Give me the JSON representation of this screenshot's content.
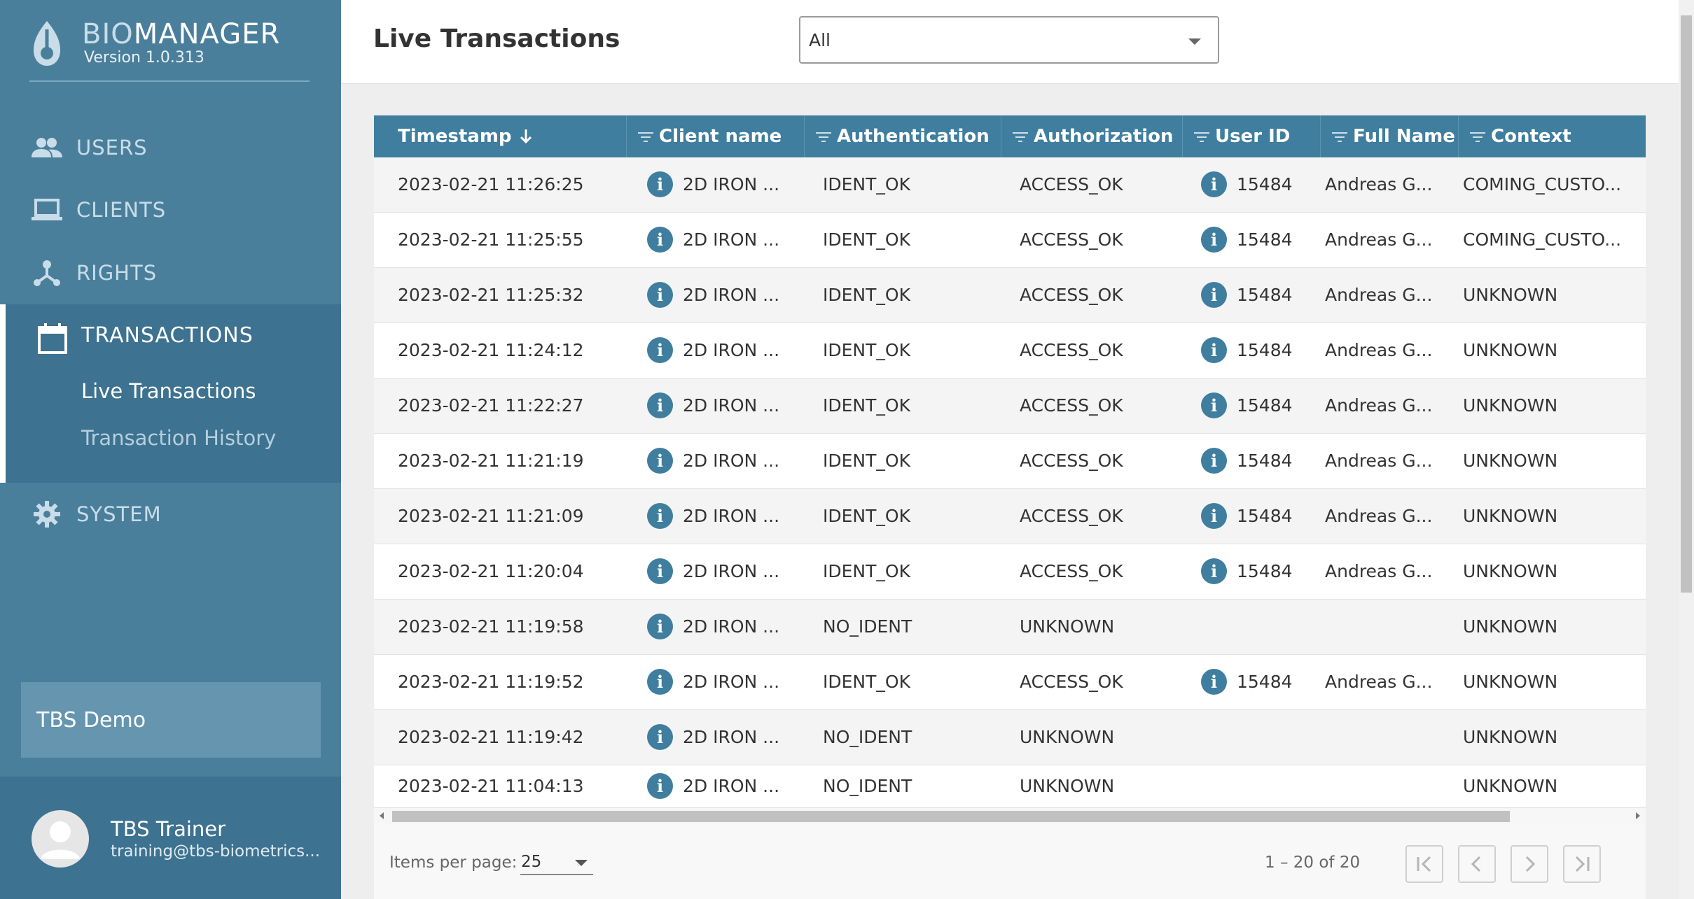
{
  "brand": {
    "name_part1": "BIO",
    "name_part2": "MANAGER",
    "version": "Version 1.0.313"
  },
  "nav": {
    "users": "USERS",
    "clients": "CLIENTS",
    "rights": "RIGHTS",
    "transactions": "TRANSACTIONS",
    "sub_live": "Live Transactions",
    "sub_history": "Transaction History",
    "system": "SYSTEM"
  },
  "tenant": "TBS Demo",
  "user": {
    "name": "TBS Trainer",
    "email": "training@tbs-biometrics..."
  },
  "header": {
    "title": "Live Transactions",
    "filter_value": "All"
  },
  "table": {
    "columns": [
      "Timestamp",
      "Client name",
      "Authentication",
      "Authorization",
      "User ID",
      "Full Name",
      "Context"
    ],
    "rows": [
      [
        "2023-02-21 11:26:25",
        "2D IRON ...",
        "IDENT_OK",
        "ACCESS_OK",
        "15484",
        "Andreas G...",
        "COMING_CUSTO..."
      ],
      [
        "2023-02-21 11:25:55",
        "2D IRON ...",
        "IDENT_OK",
        "ACCESS_OK",
        "15484",
        "Andreas G...",
        "COMING_CUSTO..."
      ],
      [
        "2023-02-21 11:25:32",
        "2D IRON ...",
        "IDENT_OK",
        "ACCESS_OK",
        "15484",
        "Andreas G...",
        "UNKNOWN"
      ],
      [
        "2023-02-21 11:24:12",
        "2D IRON ...",
        "IDENT_OK",
        "ACCESS_OK",
        "15484",
        "Andreas G...",
        "UNKNOWN"
      ],
      [
        "2023-02-21 11:22:27",
        "2D IRON ...",
        "IDENT_OK",
        "ACCESS_OK",
        "15484",
        "Andreas G...",
        "UNKNOWN"
      ],
      [
        "2023-02-21 11:21:19",
        "2D IRON ...",
        "IDENT_OK",
        "ACCESS_OK",
        "15484",
        "Andreas G...",
        "UNKNOWN"
      ],
      [
        "2023-02-21 11:21:09",
        "2D IRON ...",
        "IDENT_OK",
        "ACCESS_OK",
        "15484",
        "Andreas G...",
        "UNKNOWN"
      ],
      [
        "2023-02-21 11:20:04",
        "2D IRON ...",
        "IDENT_OK",
        "ACCESS_OK",
        "15484",
        "Andreas G...",
        "UNKNOWN"
      ],
      [
        "2023-02-21 11:19:58",
        "2D IRON ...",
        "NO_IDENT",
        "UNKNOWN",
        "",
        "",
        "UNKNOWN"
      ],
      [
        "2023-02-21 11:19:52",
        "2D IRON ...",
        "IDENT_OK",
        "ACCESS_OK",
        "15484",
        "Andreas G...",
        "UNKNOWN"
      ],
      [
        "2023-02-21 11:19:42",
        "2D IRON ...",
        "NO_IDENT",
        "UNKNOWN",
        "",
        "",
        "UNKNOWN"
      ],
      [
        "2023-02-21 11:04:13",
        "2D IRON ...",
        "NO_IDENT",
        "UNKNOWN",
        "",
        "",
        "UNKNOWN"
      ]
    ]
  },
  "paginator": {
    "items_per_page_label": "Items per page:",
    "items_per_page": "25",
    "range": "1 – 20 of 20"
  },
  "colors": {
    "sidebar": "#4a7f9c",
    "accent": "#3f7e9e"
  }
}
